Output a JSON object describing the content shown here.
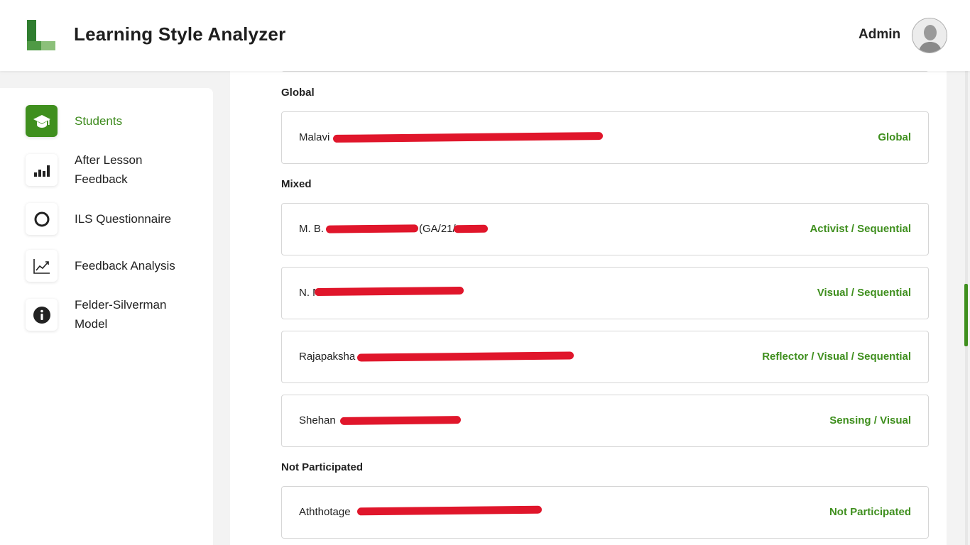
{
  "header": {
    "app_title": "Learning Style Analyzer",
    "user_name": "Admin"
  },
  "sidebar": {
    "items": [
      {
        "label": "Students",
        "icon": "graduation-cap-icon",
        "active": true
      },
      {
        "label": "After Lesson Feedback",
        "icon": "bar-chart-icon",
        "active": false
      },
      {
        "label": "ILS Questionnaire",
        "icon": "circle-icon",
        "active": false
      },
      {
        "label": "Feedback Analysis",
        "icon": "line-chart-icon",
        "active": false
      },
      {
        "label": "Felder-Silverman Model",
        "icon": "info-icon",
        "active": false
      }
    ]
  },
  "groups": [
    {
      "heading": "Global",
      "students": [
        {
          "name": "Malavi",
          "style": "Global"
        }
      ]
    },
    {
      "heading": "Mixed",
      "students": [
        {
          "name": "M. B.",
          "name_suffix": "(GA/21/",
          "style": "Activist / Sequential"
        },
        {
          "name": "N. N",
          "style": "Visual / Sequential"
        },
        {
          "name": "Rajapaksha",
          "style": "Reflector / Visual / Sequential"
        },
        {
          "name": "Shehan",
          "style": "Sensing / Visual"
        }
      ]
    },
    {
      "heading": "Not Participated",
      "students": [
        {
          "name": "Aththotage",
          "style": "Not Participated"
        }
      ]
    }
  ],
  "colors": {
    "accent": "#3f8f1e",
    "redaction": "#e0162b"
  }
}
